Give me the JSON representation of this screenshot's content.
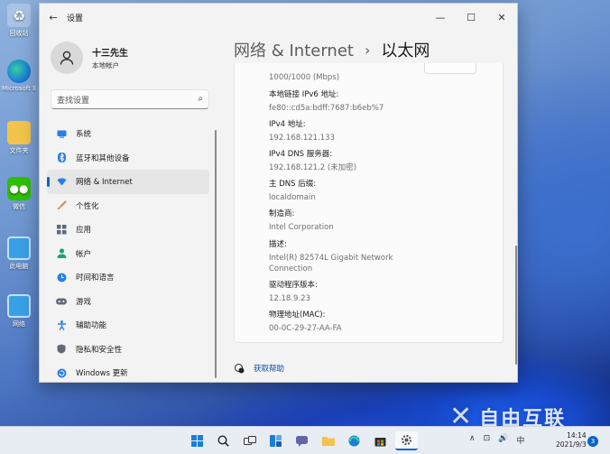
{
  "desktop": {
    "icons": [
      {
        "label": "回收站",
        "icon": "recycle-bin-icon"
      },
      {
        "label": "Microsoft Edge",
        "icon": "edge-icon"
      },
      {
        "label": "文件夹",
        "icon": "folder-icon"
      },
      {
        "label": "微信",
        "icon": "wechat-icon"
      },
      {
        "label": "此电脑",
        "icon": "computer-icon"
      },
      {
        "label": "网络",
        "icon": "network-icon"
      }
    ]
  },
  "window": {
    "title": "设置",
    "controls": {
      "minimize": "—",
      "maximize": "☐",
      "close": "✕"
    }
  },
  "profile": {
    "name": "十三先生",
    "account": "本地帐户"
  },
  "search": {
    "placeholder": "查找设置"
  },
  "nav": {
    "items": [
      {
        "label": "系统",
        "icon": "monitor-icon",
        "color": "#2b7de9"
      },
      {
        "label": "蓝牙和其他设备",
        "icon": "bluetooth-icon",
        "color": "#2b7de9"
      },
      {
        "label": "网络 & Internet",
        "icon": "wifi-icon",
        "color": "#2b7de9",
        "active": true
      },
      {
        "label": "个性化",
        "icon": "brush-icon",
        "color": "#e0853a"
      },
      {
        "label": "应用",
        "icon": "apps-icon",
        "color": "#5d6a7a"
      },
      {
        "label": "帐户",
        "icon": "person-icon",
        "color": "#19a37a"
      },
      {
        "label": "时间和语言",
        "icon": "globe-clock-icon",
        "color": "#2b7de9"
      },
      {
        "label": "游戏",
        "icon": "gamepad-icon",
        "color": "#5d6a7a"
      },
      {
        "label": "辅助功能",
        "icon": "accessibility-icon",
        "color": "#2b7de9"
      },
      {
        "label": "隐私和安全性",
        "icon": "shield-icon",
        "color": "#5d6a7a"
      },
      {
        "label": "Windows 更新",
        "icon": "update-icon",
        "color": "#2b7de9"
      }
    ]
  },
  "breadcrumb": {
    "parent": "网络 & Internet",
    "separator": "›",
    "current": "以太网"
  },
  "properties": [
    {
      "label": "",
      "value": "1000/1000 (Mbps)"
    },
    {
      "label": "本地链接 IPv6 地址:",
      "value": "fe80::cd5a:bdff:7687:b6eb%7"
    },
    {
      "label": "IPv4 地址:",
      "value": "192.168.121.133"
    },
    {
      "label": "IPv4 DNS 服务器:",
      "value": "192.168.121.2 (未加密)"
    },
    {
      "label": "主 DNS 后缀:",
      "value": "localdomain"
    },
    {
      "label": "制造商:",
      "value": "Intel Corporation"
    },
    {
      "label": "描述:",
      "value": "Intel(R) 82574L Gigabit Network Connection"
    },
    {
      "label": "驱动程序版本:",
      "value": "12.18.9.23"
    },
    {
      "label": "物理地址(MAC):",
      "value": "00-0C-29-27-AA-FA"
    }
  ],
  "help": {
    "label": "获取帮助"
  },
  "taskbar": {
    "tray": {
      "chevron": "∧",
      "network": "⊡",
      "volume": "🔊",
      "ime": "中"
    },
    "clock": {
      "time": "14:14",
      "date": "2021/9/3"
    },
    "notification_count": "3"
  },
  "watermark": {
    "text": "自由互联"
  }
}
